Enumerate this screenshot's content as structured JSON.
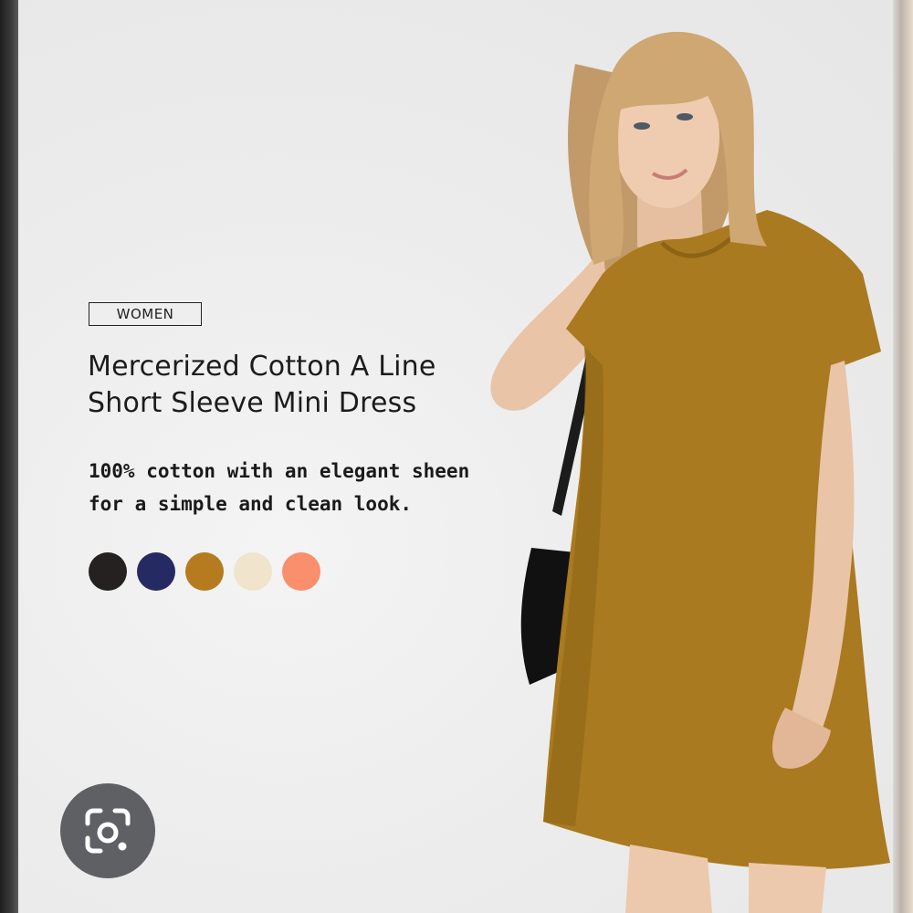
{
  "category": {
    "label": "WOMEN"
  },
  "product": {
    "title_line1": "Mercerized Cotton A Line",
    "title_line2": "Short Sleeve Mini Dress",
    "desc_line1": "100% cotton with an elegant sheen",
    "desc_line2": "for a simple and clean look."
  },
  "colors": {
    "swatches": [
      "#242120",
      "#262a62",
      "#b57b1e",
      "#f0e4cc",
      "#f98f6c"
    ],
    "dress": "#a97a1f",
    "accent_background": "#ededed"
  },
  "icons": {
    "lens": "camera-search-icon"
  }
}
